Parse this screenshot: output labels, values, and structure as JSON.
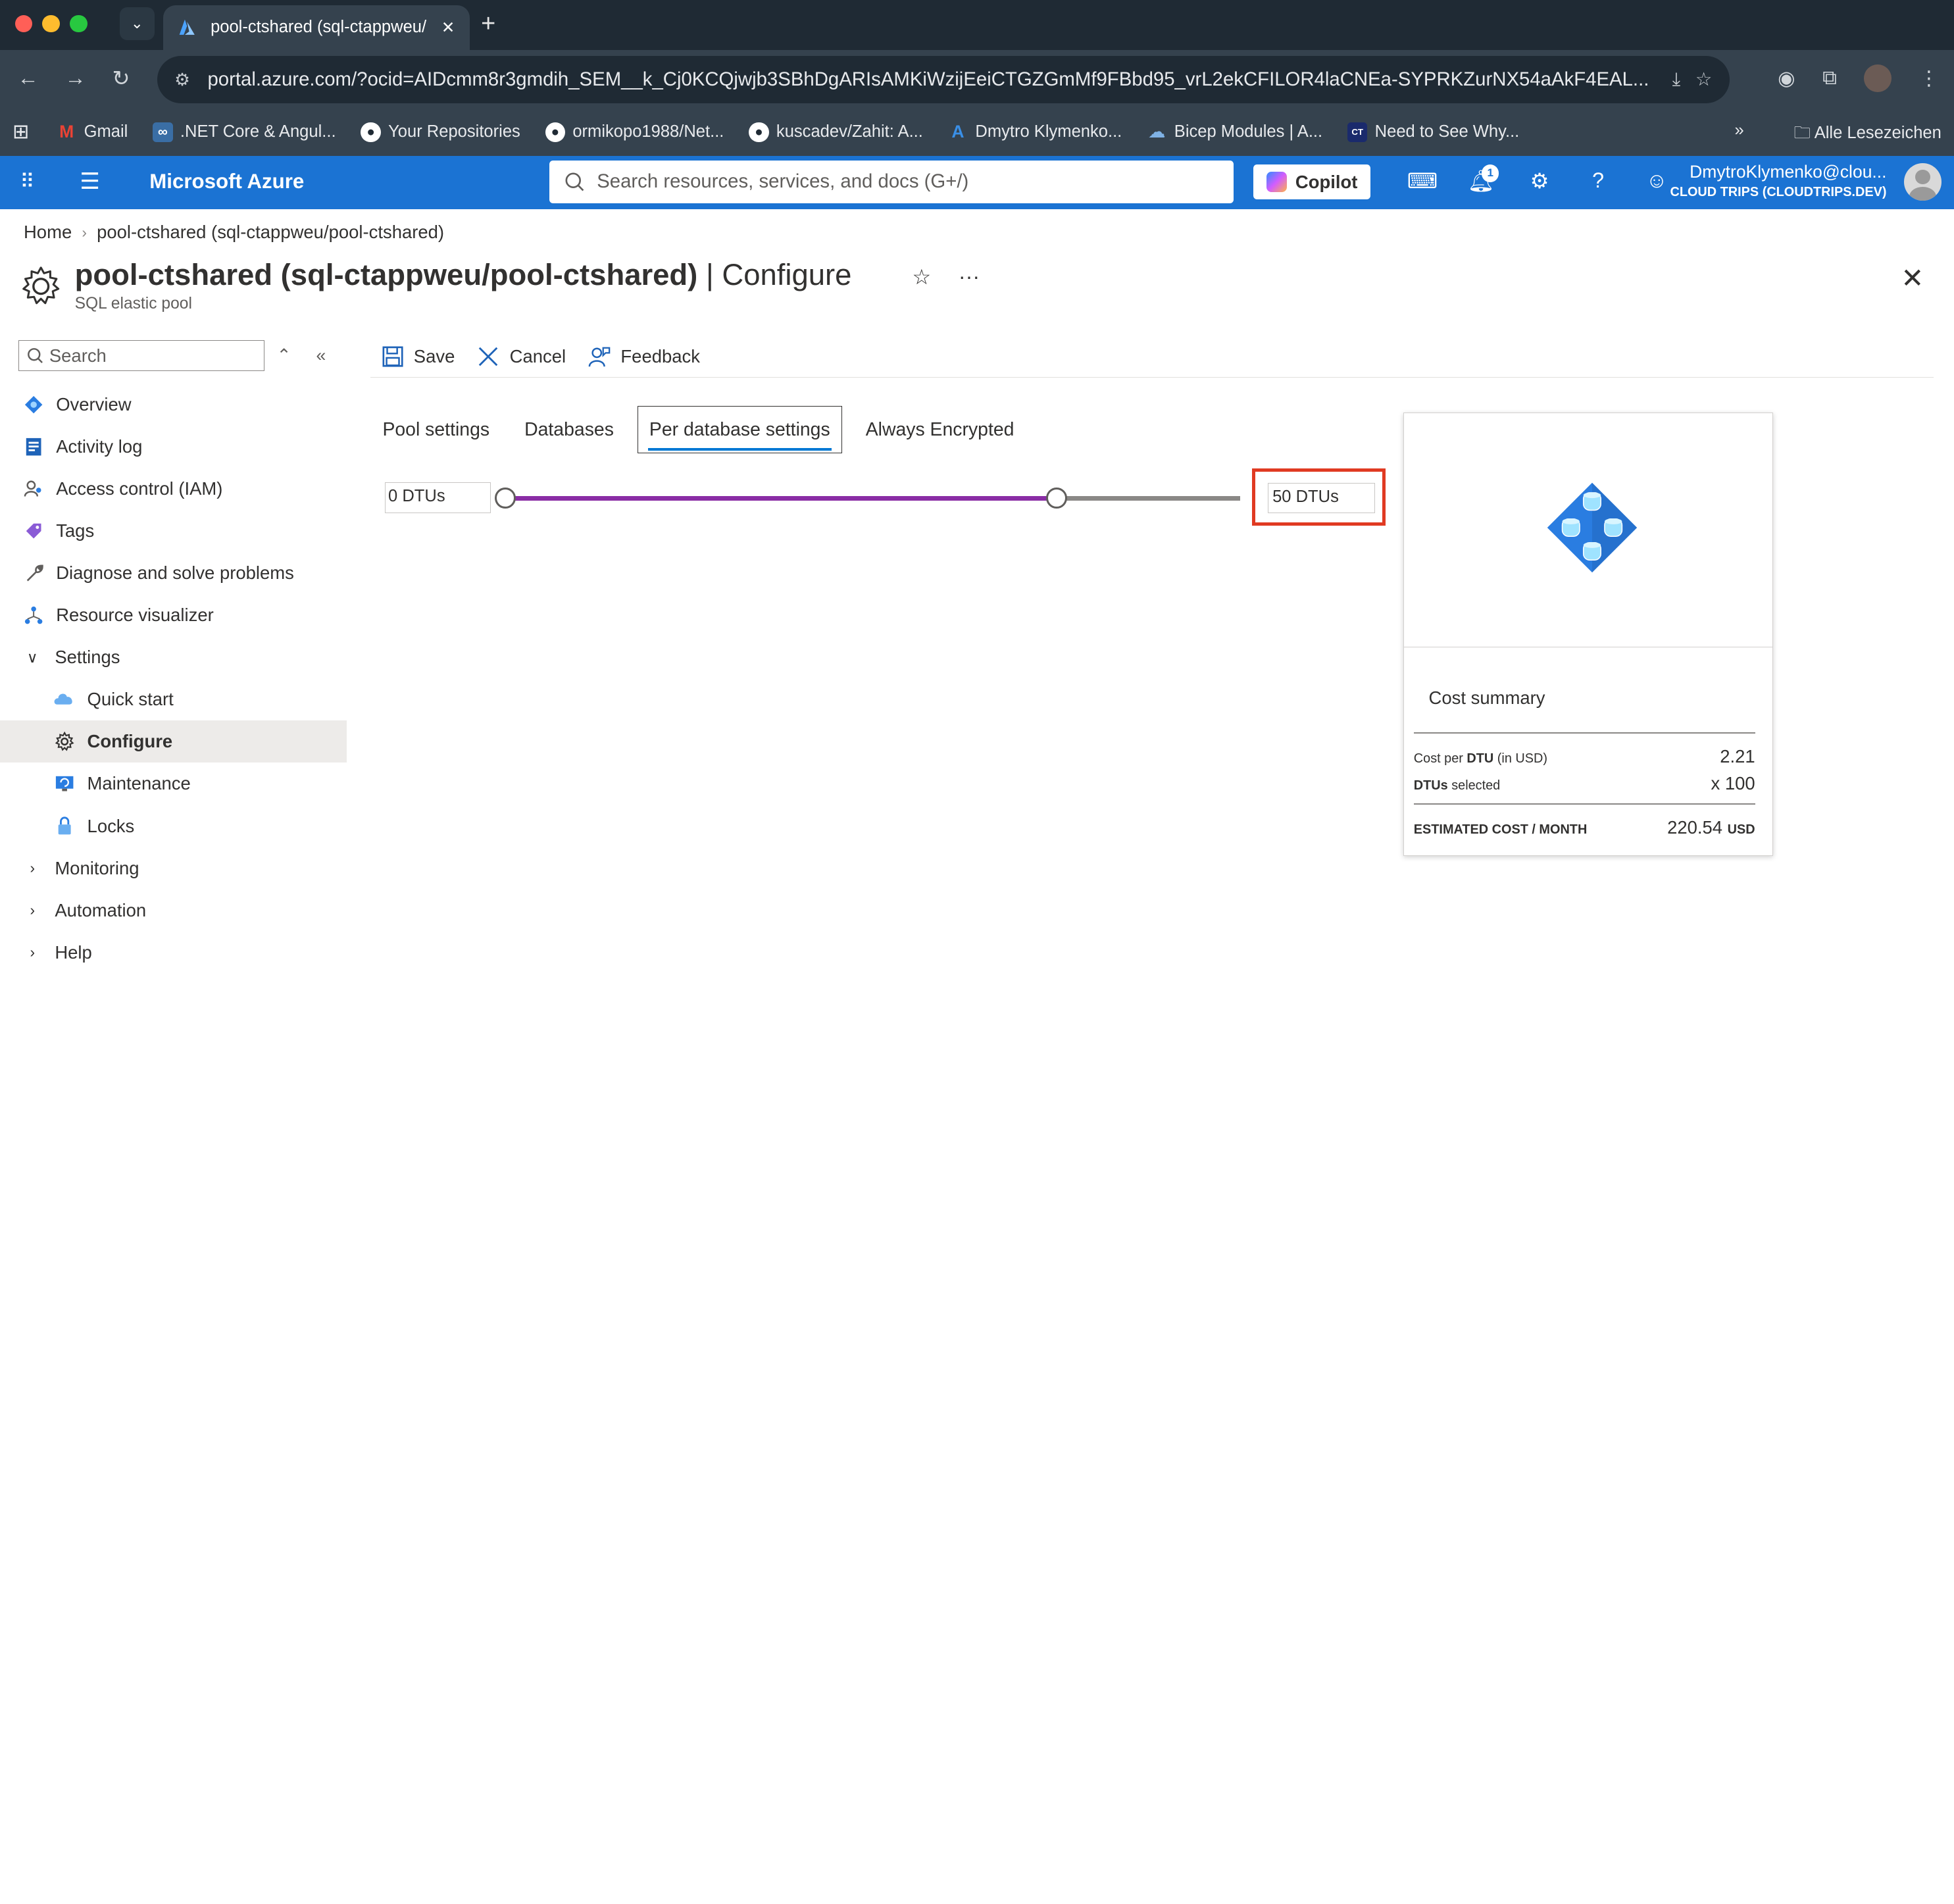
{
  "browser": {
    "tab_title": "pool-ctshared (sql-ctappweu/",
    "url": "portal.azure.com/?ocid=AIDcmm8r3gmdih_SEM__k_Cj0KCQjwjb3SBhDgARIsAMKiWzijEeiCTGZGmMf9FBbd95_vrL2ekCFILOR4laCNEa-SYPRKZurNX54aAkF4EAL...",
    "bookmarks": [
      {
        "label": "Gmail",
        "icon": "gmail-icon"
      },
      {
        "label": ".NET Core & Angul...",
        "icon": "infinity-icon"
      },
      {
        "label": "Your Repositories",
        "icon": "github-icon"
      },
      {
        "label": "ormikopo1988/Net...",
        "icon": "github-icon"
      },
      {
        "label": "kuscadev/Zahit: A...",
        "icon": "github-icon"
      },
      {
        "label": "Dmytro Klymenko...",
        "icon": "azure-icon"
      },
      {
        "label": "Bicep Modules | A...",
        "icon": "cloud-icon"
      },
      {
        "label": "Need to See Why...",
        "icon": "ct-icon"
      }
    ],
    "all_bookmarks": "Alle Lesezeichen"
  },
  "azure": {
    "brand": "Microsoft Azure",
    "search_placeholder": "Search resources, services, and docs (G+/)",
    "copilot": "Copilot",
    "notification_count": "1",
    "account_name": "DmytroKlymenko@clou...",
    "account_directory": "CLOUD TRIPS (CLOUDTRIPS.DEV)"
  },
  "breadcrumb": {
    "home": "Home",
    "current": "pool-ctshared (sql-ctappweu/pool-ctshared)"
  },
  "title": {
    "resource": "pool-ctshared (sql-ctappweu/pool-ctshared)",
    "section": "| Configure",
    "subtitle": "SQL elastic pool"
  },
  "leftnav": {
    "search_placeholder": "Search",
    "items": [
      {
        "label": "Overview",
        "icon": "overview-icon"
      },
      {
        "label": "Activity log",
        "icon": "activity-log-icon"
      },
      {
        "label": "Access control (IAM)",
        "icon": "iam-icon"
      },
      {
        "label": "Tags",
        "icon": "tag-icon"
      },
      {
        "label": "Diagnose and solve problems",
        "icon": "wrench-icon"
      },
      {
        "label": "Resource visualizer",
        "icon": "visualizer-icon"
      },
      {
        "label": "Settings",
        "icon": "chevron-down-icon"
      },
      {
        "label": "Quick start",
        "icon": "quickstart-icon"
      },
      {
        "label": "Configure",
        "icon": "gear-icon"
      },
      {
        "label": "Maintenance",
        "icon": "maintenance-icon"
      },
      {
        "label": "Locks",
        "icon": "lock-icon"
      },
      {
        "label": "Monitoring",
        "icon": "chevron-right-icon"
      },
      {
        "label": "Automation",
        "icon": "chevron-right-icon"
      },
      {
        "label": "Help",
        "icon": "chevron-right-icon"
      }
    ]
  },
  "toolbar": {
    "save": "Save",
    "cancel": "Cancel",
    "feedback": "Feedback"
  },
  "tabs": [
    {
      "label": "Pool settings"
    },
    {
      "label": "Databases"
    },
    {
      "label": "Per database settings",
      "selected": true
    },
    {
      "label": "Always Encrypted"
    }
  ],
  "slider": {
    "min_value": "0 DTUs",
    "max_value": "50 DTUs",
    "range_low_fraction": 0.0,
    "range_high_fraction": 0.75,
    "fill_color": "#8a2da5"
  },
  "cost_summary": {
    "title": "Cost summary",
    "cost_per_dtu_label_pre": "Cost per ",
    "cost_per_dtu_label_bold": "DTU",
    "cost_per_dtu_label_post": " (in USD)",
    "cost_per_dtu_value": "2.21",
    "dtus_selected_bold": "DTUs",
    "dtus_selected_post": " selected",
    "dtus_selected_value": "x 100",
    "estimated_label": "ESTIMATED COST / MONTH",
    "estimated_value": "220.54",
    "estimated_unit": "USD"
  },
  "colors": {
    "azure_blue": "#1b73d3",
    "highlight_red": "#e03a22",
    "selected_tab_underline": "#0078d4"
  }
}
